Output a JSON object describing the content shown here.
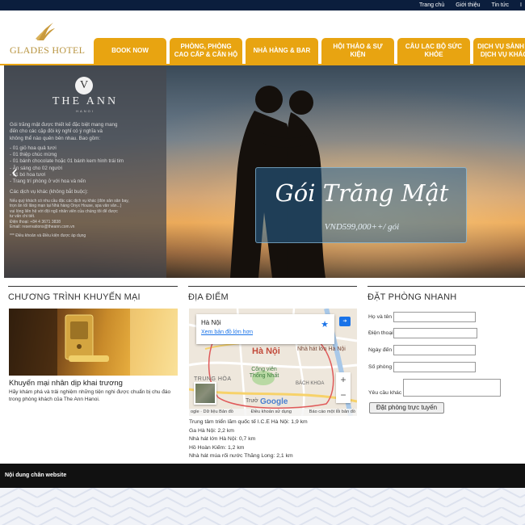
{
  "topbar": {
    "links": [
      "Trang chủ",
      "Giới thiệu",
      "Tin tức",
      "I"
    ]
  },
  "logo": {
    "text": "GLADES HOTEL"
  },
  "nav": {
    "items": [
      "BOOK NOW",
      "PHÒNG, PHÒNG CAO CẤP & CĂN HỘ",
      "NHÀ HÀNG & BAR",
      "HỘI THẢO & SỰ KIỆN",
      "CÂU LẠC BỘ SỨC KHỎE",
      "DỊCH VỤ SẢNH & DỊCH VỤ KHÁC"
    ]
  },
  "slider": {
    "brand_logo": "V",
    "brand_name": "THE ANN",
    "brand_sub": "HANOI",
    "promo_lines": [
      "Gói trăng mật được thiết kế đặc biệt mang mang",
      "đến cho các cặp đôi kỳ nghỉ có ý nghĩa và",
      "không thể nào quên bên nhau. Bao gồm:",
      "",
      "- 01 giỏ hoa quả tươi",
      "- 01 thiệp chúc mừng",
      "- 01 bánh chocolate hoặc 01 bánh kem hình trái tim",
      "- Ăn sáng cho 02 người",
      "- 01 bó hoa tươi",
      "- Trang trí phòng ở với hoa và nến",
      "",
      "Các dịch vụ khác (không bắt buộc):"
    ],
    "promo_small": [
      "Nếu quý khách có nhu cầu đặc các dịch vụ khác (đón sân sân bay,",
      "trọn ăn tối lãng mạn tại Nhà hàng Onyx House, spa vân vân...)",
      "vui lòng liên hệ với đội ngũ nhân viên của chúng tôi để được",
      "tư vấn chi tiết.",
      "Điện thoại: +84 4 3671 3838",
      "Email: reservations@theann.com.vn",
      "",
      "*** Điều khoản và Điều kiện được áp dụng"
    ],
    "package_title": "Gói Trăng Mật",
    "package_price": "VND599,000++/ gói",
    "prev_arrow": "‹"
  },
  "sections": {
    "promo_title": "CHƯƠNG TRÌNH KHUYẾN MẠI",
    "location_title": "ĐỊA ĐIỂM",
    "booking_title": "ĐẶT PHÒNG NHANH"
  },
  "promo": {
    "heading": "Khuyến mại nhân dịp khai trương",
    "description": "Hãy khám phá và trải nghiệm những tiện nghi được chuẩn bị chu đáo trong phòng khách của The Ann Hanoi."
  },
  "map": {
    "card_city": "Hà Nội",
    "card_link": "Xem bản đồ lớn hơn",
    "labels": {
      "hanoi": "Hà Nội",
      "opera": "Nhà hát lớn Hà Nội",
      "park": "Công viên Thống Nhất",
      "trung_hoa": "TRUNG HÒA",
      "bach_khoa": "BÁCH KHOA",
      "truong": "Trườ"
    },
    "zoom_in": "+",
    "zoom_out": "−",
    "google": "Google",
    "footer_data": "ogle · Dữ liệu Bản đồ",
    "footer_terms": "Điều khoản sử dụng",
    "footer_report": "Báo cáo một lỗi bản đồ"
  },
  "distances": [
    "Trung tâm triển lãm quốc tế I.C.E Hà Nội: 1,9 km",
    "Ga Hà Nội: 2,2 km",
    "Nhà hát lớn Hà Nội: 0,7 km",
    "Hồ Hoàn Kiếm: 1,2 km",
    "Nhà hát múa rối nước Thăng Long: 2,1 km"
  ],
  "booking": {
    "name_label": "Họ và tên",
    "phone_label": "Điện thoại",
    "date_label": "Ngày đến",
    "rooms_label": "Số phòng",
    "request_label": "Yêu cầu khác",
    "submit_label": "Đặt phòng trực tuyến"
  },
  "footer": {
    "text": "Nội dung chân website"
  },
  "colors": {
    "accent": "#e8a411",
    "topbar": "#0b1e3d",
    "footer": "#111111"
  }
}
